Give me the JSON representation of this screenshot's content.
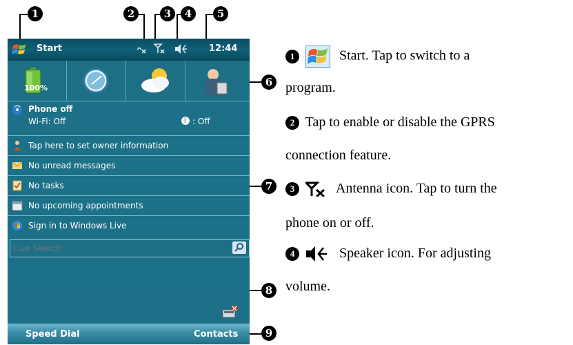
{
  "markers": [
    "1",
    "2",
    "3",
    "4",
    "5",
    "6",
    "7",
    "8",
    "9"
  ],
  "titlebar": {
    "start_label": "Start",
    "clock": "12:44"
  },
  "quick_launch": {
    "battery_label": "100%"
  },
  "today": {
    "phone_title": "Phone off",
    "wifi_status": "Wi-Fi: Off",
    "bluetooth_status": ": Off",
    "owner_info": "Tap here to set owner information",
    "messages": "No unread messages",
    "tasks": "No tasks",
    "appointments": "No upcoming appointments",
    "windows_live": "Sign in to Windows Live"
  },
  "search": {
    "placeholder": "Live Search"
  },
  "softkeys": {
    "left": "Speed Dial",
    "right": "Contacts"
  },
  "descriptions": {
    "item1_line1": "Start. Tap to switch to a",
    "item1_line2": "program.",
    "item2_line1": "Tap to enable or disable the GPRS",
    "item2_line2": "connection feature.",
    "item3_line1": "Antenna icon. Tap to turn the",
    "item3_line2": "phone on or off.",
    "item4_line1": "Speaker icon. For adjusting",
    "item4_line2": "volume."
  },
  "colors": {
    "screen_bg": "#1e6c82",
    "titlebar_bg": "#0b4d63",
    "softbar_bg": "#3d8fa8",
    "text_on_screen": "#ffffff"
  }
}
